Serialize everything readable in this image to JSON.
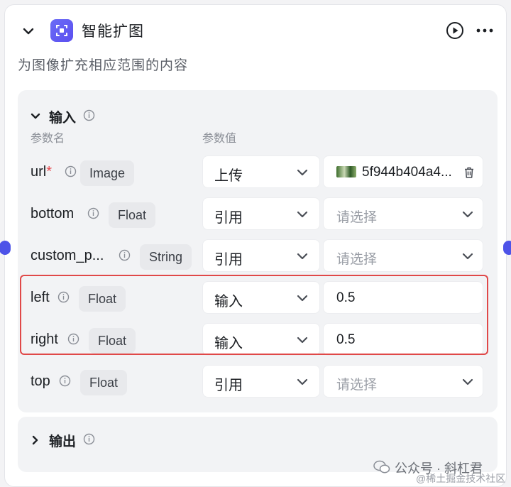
{
  "node": {
    "title": "智能扩图",
    "description": "为图像扩充相应范围的内容",
    "icon": "expand-image-icon"
  },
  "input_section": {
    "title": "输入",
    "col_name": "参数名",
    "col_value": "参数值",
    "params": [
      {
        "name": "url",
        "required_mark": "*",
        "type": "Image",
        "mode": "上传",
        "value": "5f944b404a4...",
        "value_kind": "file"
      },
      {
        "name": "bottom",
        "required_mark": "",
        "type": "Float",
        "mode": "引用",
        "value": "请选择",
        "value_kind": "select"
      },
      {
        "name": "custom_p...",
        "required_mark": "",
        "type": "String",
        "mode": "引用",
        "value": "请选择",
        "value_kind": "select"
      },
      {
        "name": "left",
        "required_mark": "",
        "type": "Float",
        "mode": "输入",
        "value": "0.5",
        "value_kind": "input"
      },
      {
        "name": "right",
        "required_mark": "",
        "type": "Float",
        "mode": "输入",
        "value": "0.5",
        "value_kind": "input"
      },
      {
        "name": "top",
        "required_mark": "",
        "type": "Float",
        "mode": "引用",
        "value": "请选择",
        "value_kind": "select"
      }
    ]
  },
  "output_section": {
    "title": "输出"
  },
  "watermark": {
    "main": "公众号 · 斜杠君",
    "sub": "@稀土掘金技术社区"
  },
  "colors": {
    "accent": "#4d53e8",
    "highlight": "#e04848",
    "required": "#e5484d"
  }
}
